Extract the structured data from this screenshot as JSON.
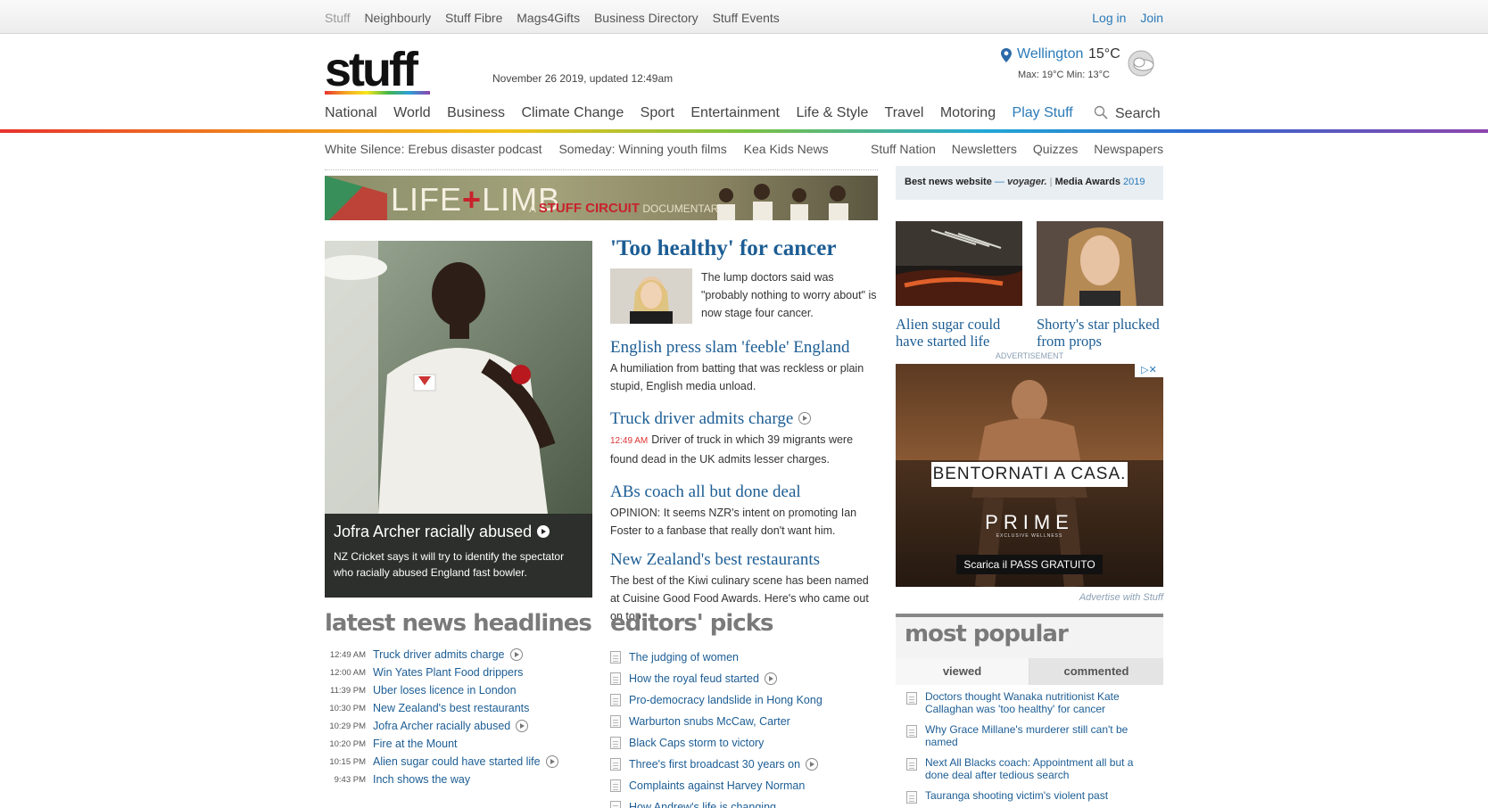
{
  "topbar": {
    "links": [
      "Stuff",
      "Neighbourly",
      "Stuff Fibre",
      "Mags4Gifts",
      "Business Directory",
      "Stuff Events"
    ],
    "login": "Log in",
    "join": "Join"
  },
  "header": {
    "logo": "stuff",
    "dateline": "November 26 2019, updated 12:49am"
  },
  "weather": {
    "city": "Wellington",
    "temp": "15°C",
    "minmax": "Max: 19°C  Min: 13°C",
    "icon": "partly-cloudy-icon"
  },
  "nav": {
    "items": [
      "National",
      "World",
      "Business",
      "Climate Change",
      "Sport",
      "Entertainment",
      "Life & Style",
      "Travel",
      "Motoring",
      "Play Stuff"
    ],
    "search": "Search"
  },
  "subnav": {
    "left": [
      "White Silence: Erebus disaster podcast",
      "Someday: Winning youth films",
      "Kea Kids News"
    ],
    "right": [
      "Stuff Nation",
      "Newsletters",
      "Quizzes",
      "Newspapers"
    ]
  },
  "banner": {
    "title_a": "LIFE",
    "title_plus": "+",
    "title_b": "LIMB",
    "sub_a": "A",
    "sub_brand": "STUFF CIRCUIT",
    "sub_b": "DOCUMENTARY"
  },
  "award": {
    "left": "Best news website",
    "sponsor": "voyager.",
    "right": "Media Awards",
    "year": "2019"
  },
  "lead": {
    "headline": "Jofra Archer racially abused",
    "summary": "NZ Cricket says it will try to identify the spectator who racially abused England fast bowler."
  },
  "main_story": {
    "headline": "'Too healthy' for cancer",
    "summary": "The lump doctors said was \"probably nothing to worry about\" is now stage four cancer."
  },
  "stories": [
    {
      "headline": "English press slam 'feeble' England",
      "time": "",
      "summary": "A humiliation from batting that was reckless or plain stupid, English media unload."
    },
    {
      "headline": "Truck driver admits charge",
      "time": "12:49 AM",
      "summary": "Driver of truck in which 39 migrants were found dead in the UK admits lesser charges."
    },
    {
      "headline": "ABs coach all but done deal",
      "time": "",
      "summary": "OPINION: It seems NZR's intent on promoting Ian Foster to a fanbase that really don't want him."
    },
    {
      "headline": "New Zealand's best restaurants",
      "time": "",
      "summary": "The best of the Kiwi culinary scene has been named at Cuisine Good Food Awards. Here's who came out on top."
    }
  ],
  "right_thumbs": [
    {
      "headline": "Alien sugar could have started life"
    },
    {
      "headline": "Shorty's star plucked from props"
    }
  ],
  "ad": {
    "label": "ADVERTISEMENT",
    "slogan": "BENTORNATI A CASA.",
    "brand": "PRIME",
    "brand_sub": "EXCLUSIVE WELLNESS",
    "cta": "Scarica il PASS GRATUITO",
    "advertise": "Advertise with Stuff"
  },
  "latest": {
    "title": "latest news headlines",
    "items": [
      {
        "time": "12:49 AM",
        "label": "Truck driver admits charge"
      },
      {
        "time": "12:00 AM",
        "label": "Win Yates Plant Food drippers"
      },
      {
        "time": "11:39 PM",
        "label": "Uber loses licence in London"
      },
      {
        "time": "10:30 PM",
        "label": "New Zealand's best restaurants"
      },
      {
        "time": "10:29 PM",
        "label": "Jofra Archer racially abused"
      },
      {
        "time": "10:20 PM",
        "label": "Fire at the Mount"
      },
      {
        "time": "10:15 PM",
        "label": "Alien sugar could have started life"
      },
      {
        "time": "9:43 PM",
        "label": "Inch shows the way"
      }
    ]
  },
  "picks": {
    "title": "editors' picks",
    "items": [
      "The judging of women",
      "How the royal feud started",
      "Pro-democracy landslide in Hong Kong",
      "Warburton snubs McCaw, Carter",
      "Black Caps storm to victory",
      "Three's first broadcast 30 years on",
      "Complaints against Harvey Norman",
      "How Andrew's life is changing"
    ]
  },
  "most_popular": {
    "title": "most popular",
    "tab_viewed": "viewed",
    "tab_commented": "commented",
    "items": [
      "Doctors thought Wanaka nutritionist Kate Callaghan was 'too healthy' for cancer",
      "Why Grace Millane's murderer still can't be named",
      "Next All Blacks coach: Appointment all but a done deal after tedious search",
      "Tauranga shooting victim's violent past"
    ]
  },
  "colors": {
    "link": "#1c5d94",
    "accent": "#2a7ab8",
    "timestamp_red": "#dd3333"
  }
}
